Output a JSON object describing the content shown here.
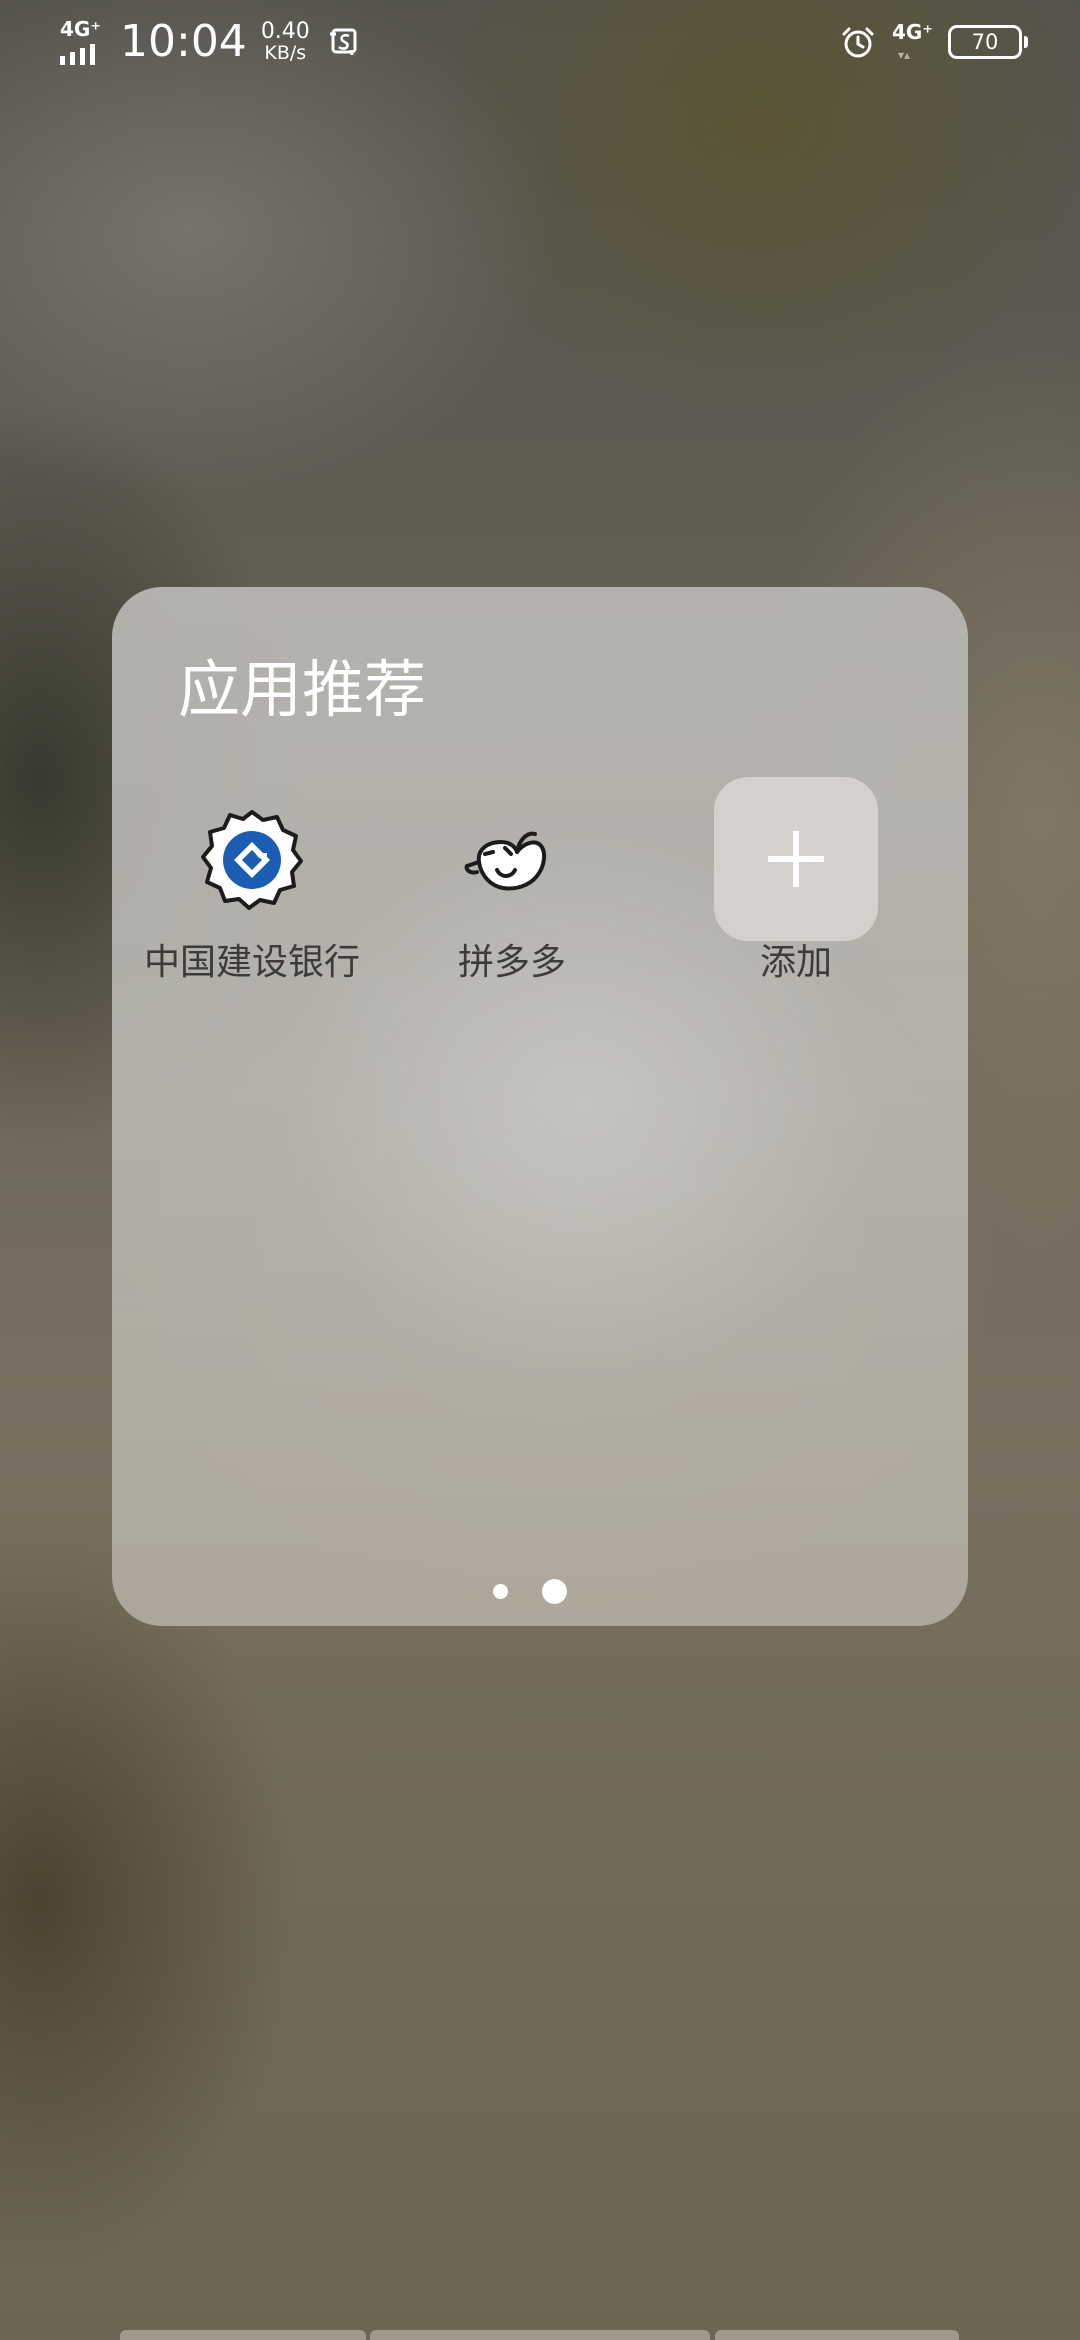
{
  "status_bar": {
    "network_left": "4G⁺",
    "time": "10:04",
    "speed_value": "0.40",
    "speed_unit": "KB/s",
    "network_right": "4G⁺",
    "battery": "70",
    "icons": [
      "signal-icon",
      "screenshot-icon",
      "alarm-icon",
      "battery-icon"
    ]
  },
  "folder": {
    "title": "应用推荐",
    "apps": [
      {
        "label": "中国建设银行",
        "icon": "ccb-bank-icon",
        "accent": "#1a5db3"
      },
      {
        "label": "拼多多",
        "icon": "pinduoduo-icon"
      },
      {
        "label": "添加",
        "icon": "plus-icon"
      }
    ],
    "pages": {
      "count": 2,
      "current": 2
    }
  }
}
